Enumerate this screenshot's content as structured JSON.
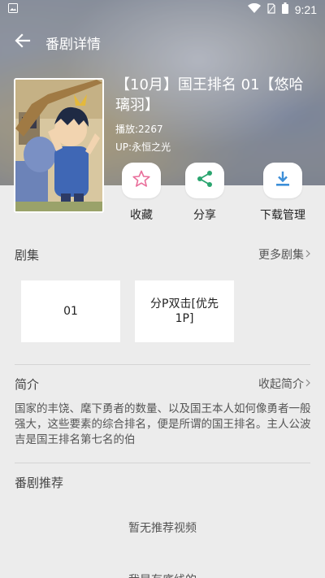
{
  "status_bar": {
    "time": "9:21",
    "icons": [
      "image-icon",
      "wifi-icon",
      "no-sim-icon",
      "battery-icon"
    ]
  },
  "app_bar": {
    "title": "番剧详情",
    "back_icon": "arrow-left-icon"
  },
  "show": {
    "title": "【10月】国王排名 01【悠哈璃羽】",
    "plays": "播放:2267",
    "uploader": "UP:永恒之光"
  },
  "actions": [
    {
      "label": "收藏",
      "icon": "star-icon"
    },
    {
      "label": "分享",
      "icon": "share-icon"
    },
    {
      "label": "下载管理",
      "icon": "download-icon"
    }
  ],
  "episodes_section": {
    "title": "剧集",
    "more_label": "更多剧集",
    "episodes": [
      "01",
      "分P双击[优先1P]"
    ]
  },
  "intro_section": {
    "title": "简介",
    "collapse_label": "收起简介",
    "text": "国家的丰饶、麾下勇者的数量、以及国王本人如何像勇者一般强大，这些要素的综合排名，便是所谓的国王排名。主人公波吉是国王排名第七名的伯"
  },
  "recommend_section": {
    "title": "番剧推荐",
    "empty_text": "暂无推荐视频",
    "bottom_text": "我是有底线的"
  },
  "colors": {
    "accent_pink": "#e96f9b",
    "accent_green": "#2aa56f",
    "accent_blue": "#3d8fd8",
    "background": "#ececec"
  }
}
